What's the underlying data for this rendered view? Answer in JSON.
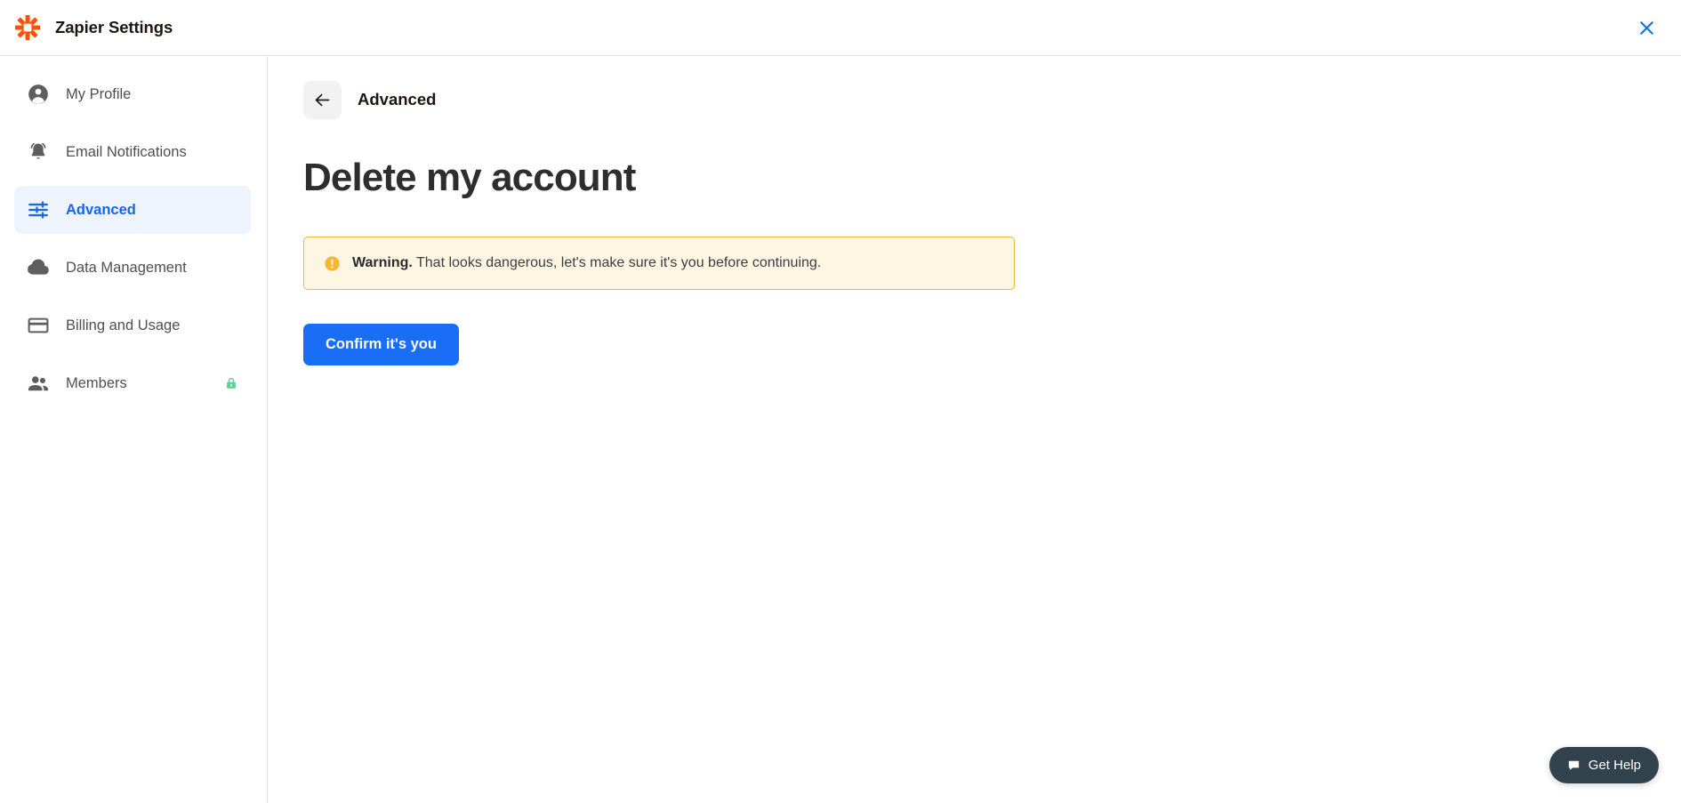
{
  "window": {
    "brand_title": "Zapier Settings",
    "logo_icon": "zapier-asterisk-icon",
    "logo_color": "#FF4F00",
    "close_icon": "close-icon",
    "close_color": "#1a6ef5"
  },
  "sidebar": {
    "items": [
      {
        "label": "My Profile",
        "icon": "account-circle-icon",
        "active": false,
        "badge": null
      },
      {
        "label": "Email Notifications",
        "icon": "notifications-active-bell-icon",
        "active": false,
        "badge": null
      },
      {
        "label": "Advanced",
        "icon": "tune-sliders-icon",
        "active": true,
        "badge": null
      },
      {
        "label": "Data Management",
        "icon": "cloud-icon",
        "active": false,
        "badge": null
      },
      {
        "label": "Billing and Usage",
        "icon": "credit-card-icon",
        "active": false,
        "badge": null
      },
      {
        "label": "Members",
        "icon": "people-group-icon",
        "active": false,
        "badge": "lock-icon"
      }
    ],
    "active_bg": "#eef4fe",
    "active_color": "#1666f0",
    "badge_color": "#5fcf93"
  },
  "main": {
    "back_icon": "arrow-left-icon",
    "breadcrumb_title": "Advanced",
    "page_title": "Delete my account",
    "alert": {
      "icon": "warning-exclamation-circle-icon",
      "icon_color": "#f5b730",
      "strong_text": "Warning.",
      "body_text": "That looks dangerous, let's make sure it's you before continuing.",
      "border_color": "#f0b93b",
      "background_color": "#fdf6e3"
    },
    "confirm_button": {
      "label": "Confirm it's you",
      "background_color": "#1a6ef5",
      "text_color": "#ffffff"
    }
  },
  "help_widget": {
    "label": "Get Help",
    "icon": "chat-bubble-icon",
    "background_color": "#32434e",
    "text_color": "#ffffff"
  }
}
